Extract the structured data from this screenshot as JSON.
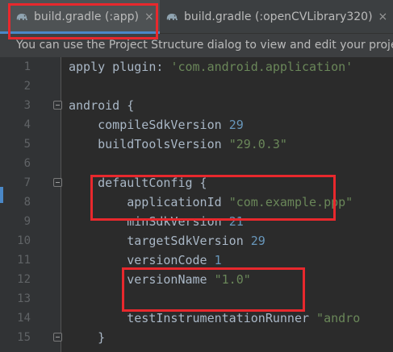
{
  "tabs": [
    {
      "label": "build.gradle (:app)",
      "close": "×",
      "active": true
    },
    {
      "label": "build.gradle (:openCVLibrary320)",
      "close": "×",
      "active": false
    }
  ],
  "banner": {
    "text": "You can use the Project Structure dialog to view and edit your project"
  },
  "editor": {
    "lines": [
      {
        "number": "1",
        "parts": [
          {
            "t": "apply plugin: ",
            "c": "plain"
          },
          {
            "t": "'com.android.application'",
            "c": "str"
          }
        ]
      },
      {
        "number": "2",
        "parts": []
      },
      {
        "number": "3",
        "parts": [
          {
            "t": "android {",
            "c": "plain"
          }
        ]
      },
      {
        "number": "4",
        "parts": [
          {
            "t": "    compileSdkVersion ",
            "c": "plain"
          },
          {
            "t": "29",
            "c": "num"
          }
        ]
      },
      {
        "number": "5",
        "parts": [
          {
            "t": "    buildToolsVersion ",
            "c": "plain"
          },
          {
            "t": "\"29.0.3\"",
            "c": "str"
          }
        ]
      },
      {
        "number": "6",
        "parts": []
      },
      {
        "number": "7",
        "parts": [
          {
            "t": "    defaultConfig {",
            "c": "plain"
          }
        ]
      },
      {
        "number": "8",
        "parts": [
          {
            "t": "        applicationId ",
            "c": "plain"
          },
          {
            "t": "\"com.example.ppp\"",
            "c": "str"
          }
        ]
      },
      {
        "number": "9",
        "parts": [
          {
            "t": "        minSdkVersion ",
            "c": "plain"
          },
          {
            "t": "21",
            "c": "num"
          }
        ]
      },
      {
        "number": "10",
        "parts": [
          {
            "t": "        targetSdkVersion ",
            "c": "plain"
          },
          {
            "t": "29",
            "c": "num"
          }
        ]
      },
      {
        "number": "11",
        "parts": [
          {
            "t": "        versionCode ",
            "c": "plain"
          },
          {
            "t": "1",
            "c": "num"
          }
        ]
      },
      {
        "number": "12",
        "parts": [
          {
            "t": "        versionName ",
            "c": "plain"
          },
          {
            "t": "\"1.0\"",
            "c": "str"
          }
        ]
      },
      {
        "number": "13",
        "parts": []
      },
      {
        "number": "14",
        "parts": [
          {
            "t": "        testInstrumentationRunner ",
            "c": "plain"
          },
          {
            "t": "\"andro",
            "c": "str"
          }
        ]
      },
      {
        "number": "15",
        "parts": [
          {
            "t": "    }",
            "c": "plain"
          }
        ]
      }
    ],
    "fold_lines": [
      "3",
      "7",
      "15"
    ]
  },
  "colors": {
    "background": "#2b2b2b",
    "keyword_plain": "#a9b7c6",
    "string": "#6a8759",
    "number": "#6897bb",
    "annotation_red": "#e8282d",
    "active_tab_underline": "#4a88c7"
  },
  "icons": {
    "tab_icon": "gradle-elephant-icon",
    "fold_icon": "fold-marker-icon"
  }
}
